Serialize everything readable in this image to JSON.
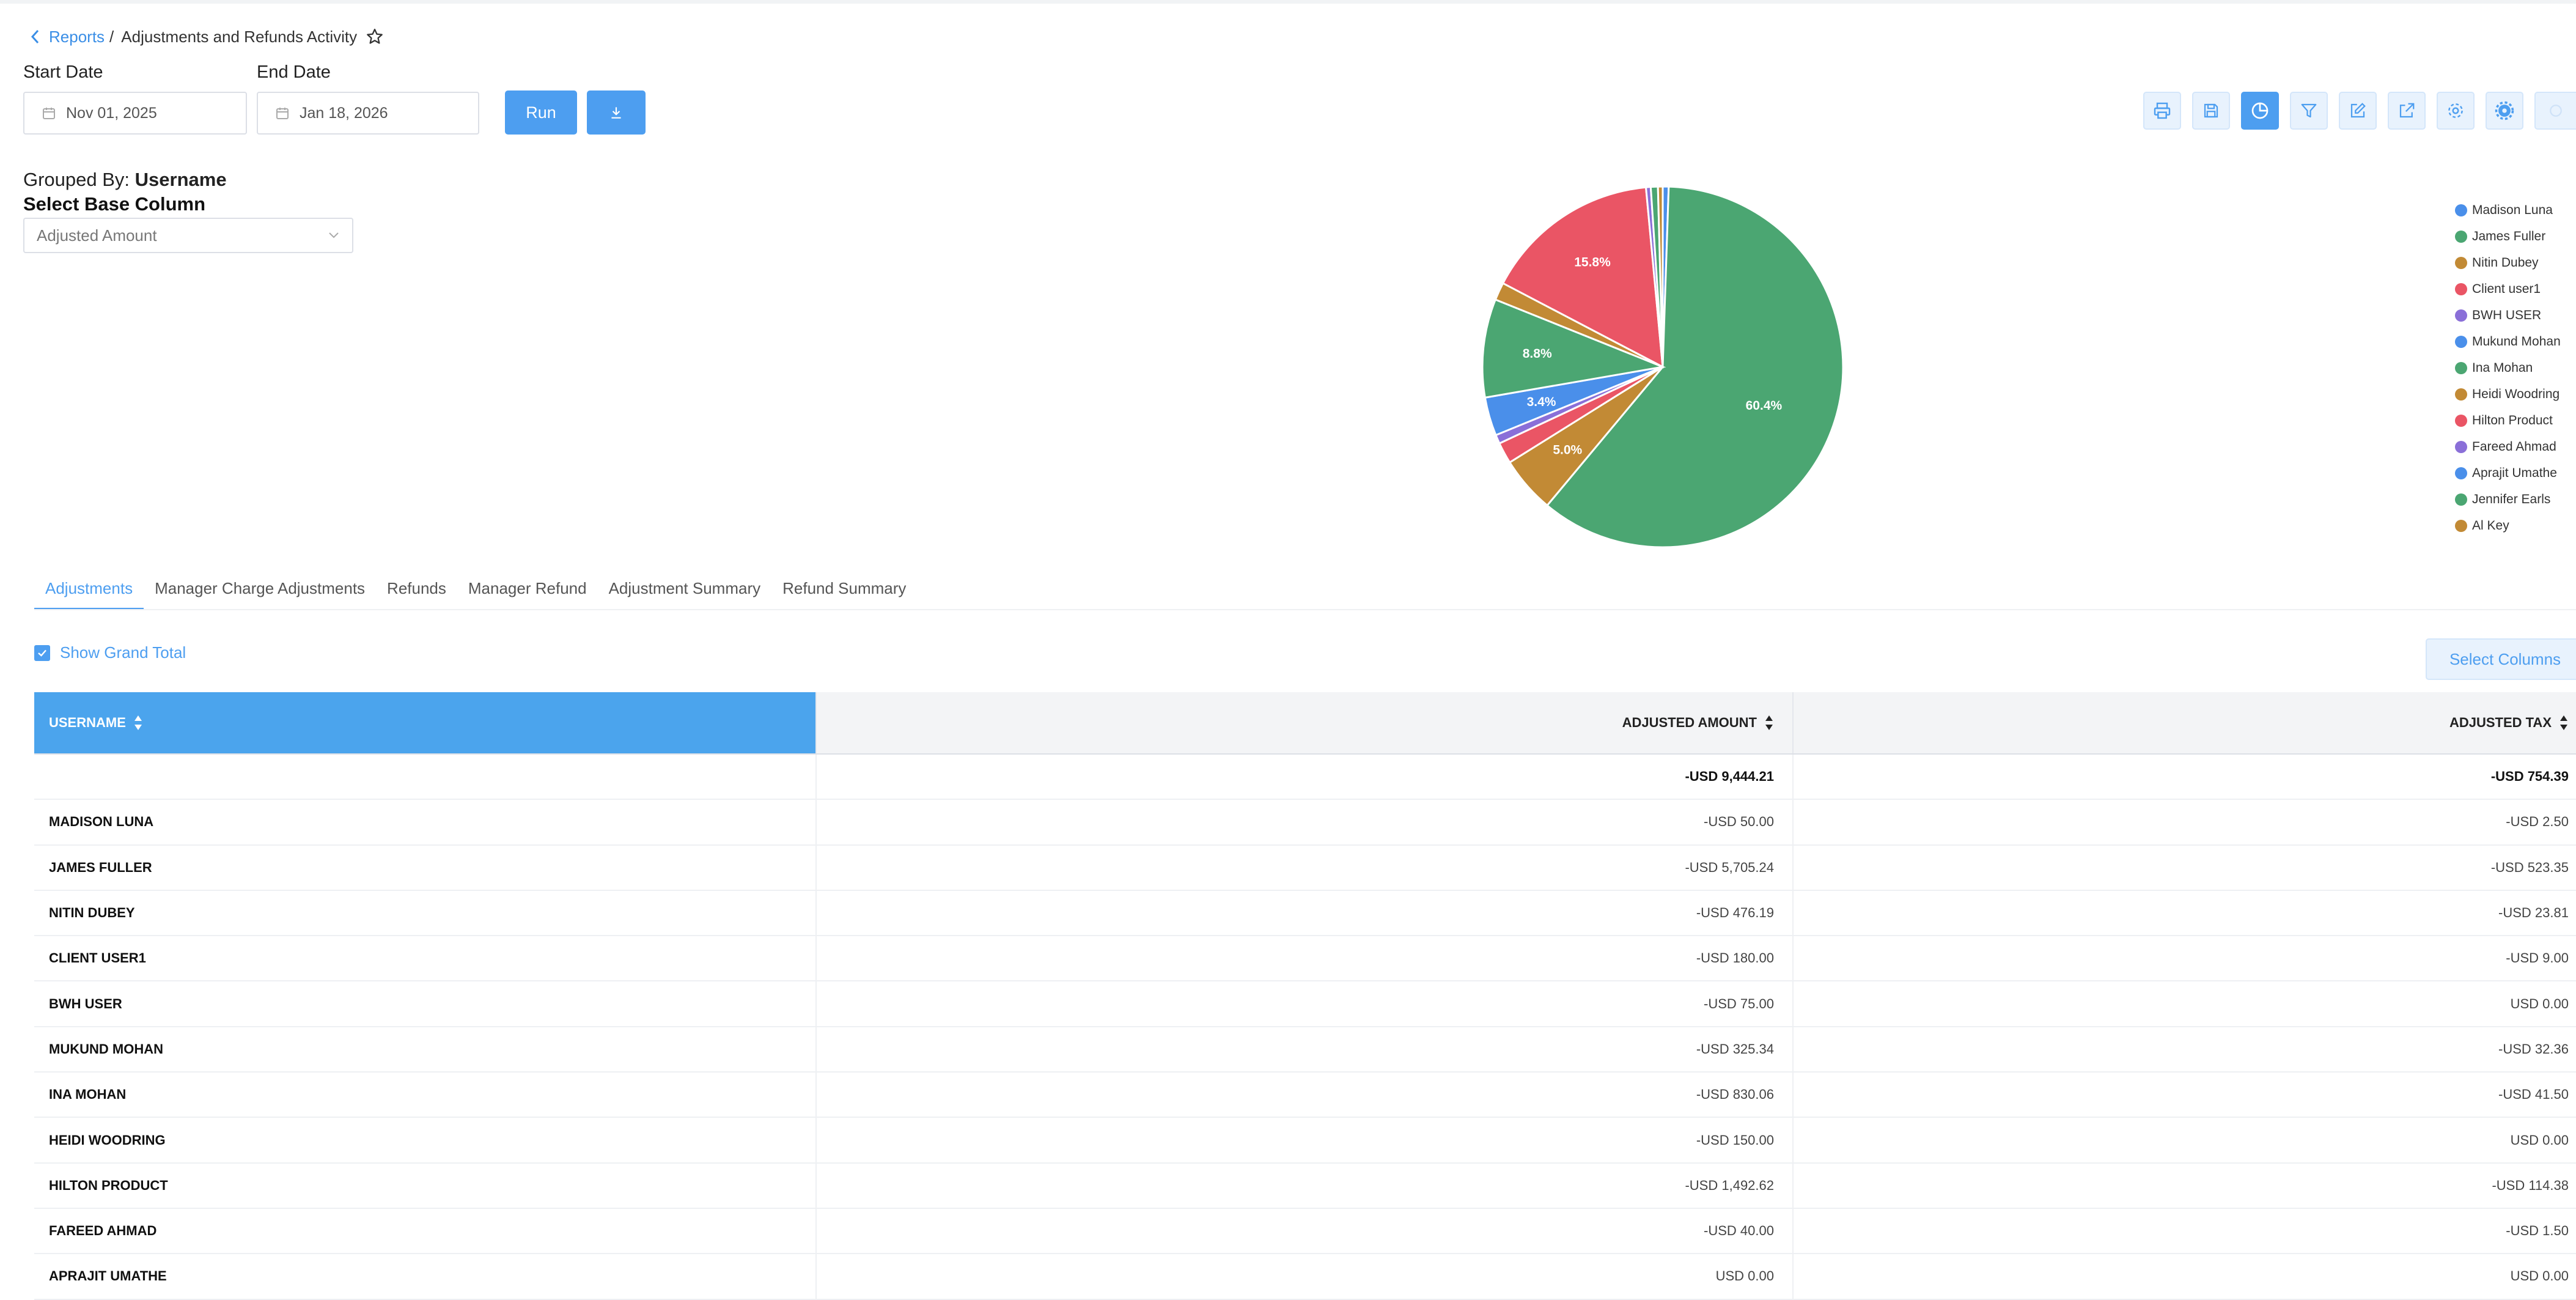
{
  "breadcrumb": {
    "parent": "Reports",
    "separator": "/",
    "title": "Adjustments and Refunds Activity"
  },
  "filters": {
    "start_label": "Start Date",
    "start_value": "Nov 01, 2025",
    "end_label": "End Date",
    "end_value": "Jan 18, 2026",
    "run_label": "Run"
  },
  "toolbar": [
    "print-icon",
    "save-icon",
    "pie-chart-icon",
    "filter-icon",
    "edit-icon",
    "export-icon",
    "settings-icon",
    "advanced-settings-icon",
    "refresh-icon"
  ],
  "grouping": {
    "label": "Grouped By:",
    "value": "Username",
    "base_label": "Select Base Column",
    "base_value": "Adjusted Amount"
  },
  "chart_data": {
    "type": "pie",
    "legend_position": "right",
    "slices": [
      {
        "name": "Madison Luna",
        "value": 50.0,
        "color": "#4a8fea"
      },
      {
        "name": "James Fuller",
        "value": 5705.24,
        "color": "#4ba672",
        "label": "60.4%"
      },
      {
        "name": "Nitin Dubey",
        "value": 476.19,
        "color": "#c28a35",
        "label": "5.0%"
      },
      {
        "name": "Client user1",
        "value": 180.0,
        "color": "#ea5565"
      },
      {
        "name": "BWH USER",
        "value": 75.0,
        "color": "#8a6fd8"
      },
      {
        "name": "Mukund Mohan",
        "value": 325.34,
        "color": "#4a8fea",
        "label": "3.4%"
      },
      {
        "name": "Ina Mohan",
        "value": 830.06,
        "color": "#4ba672",
        "label": "8.8%"
      },
      {
        "name": "Heidi Woodring",
        "value": 150.0,
        "color": "#c28a35"
      },
      {
        "name": "Hilton Product",
        "value": 1492.62,
        "color": "#ea5565",
        "label": "15.8%"
      },
      {
        "name": "Fareed Ahmad",
        "value": 40.0,
        "color": "#8a6fd8"
      },
      {
        "name": "Aprajit Umathe",
        "value": 0.0,
        "color": "#4a8fea"
      },
      {
        "name": "Jennifer Earls",
        "value": 60.0,
        "color": "#4ba672"
      },
      {
        "name": "Al Key",
        "value": 40.0,
        "color": "#c28a35"
      }
    ]
  },
  "legend": [
    {
      "name": "Madison Luna",
      "color": "#4a8fea"
    },
    {
      "name": "James Fuller",
      "color": "#4ba672"
    },
    {
      "name": "Nitin Dubey",
      "color": "#c28a35"
    },
    {
      "name": "Client user1",
      "color": "#ea5565"
    },
    {
      "name": "BWH USER",
      "color": "#8a6fd8"
    },
    {
      "name": "Mukund Mohan",
      "color": "#4a8fea"
    },
    {
      "name": "Ina Mohan",
      "color": "#4ba672"
    },
    {
      "name": "Heidi Woodring",
      "color": "#c28a35"
    },
    {
      "name": "Hilton Product",
      "color": "#ea5565"
    },
    {
      "name": "Fareed Ahmad",
      "color": "#8a6fd8"
    },
    {
      "name": "Aprajit Umathe",
      "color": "#4a8fea"
    },
    {
      "name": "Jennifer Earls",
      "color": "#4ba672"
    },
    {
      "name": "Al Key",
      "color": "#c28a35"
    }
  ],
  "tabs": [
    "Adjustments",
    "Manager Charge Adjustments",
    "Refunds",
    "Manager Refund",
    "Adjustment Summary",
    "Refund Summary"
  ],
  "active_tab": 0,
  "grand_total_label": "Show Grand Total",
  "select_columns_label": "Select Columns",
  "table": {
    "headers": [
      "USERNAME",
      "ADJUSTED AMOUNT",
      "ADJUSTED TAX"
    ],
    "total": [
      "",
      "-USD 9,444.21",
      "-USD 754.39"
    ],
    "rows": [
      [
        "MADISON LUNA",
        "-USD 50.00",
        "-USD 2.50"
      ],
      [
        "JAMES FULLER",
        "-USD 5,705.24",
        "-USD 523.35"
      ],
      [
        "NITIN DUBEY",
        "-USD 476.19",
        "-USD 23.81"
      ],
      [
        "CLIENT USER1",
        "-USD 180.00",
        "-USD 9.00"
      ],
      [
        "BWH USER",
        "-USD 75.00",
        "USD 0.00"
      ],
      [
        "MUKUND MOHAN",
        "-USD 325.34",
        "-USD 32.36"
      ],
      [
        "INA MOHAN",
        "-USD 830.06",
        "-USD 41.50"
      ],
      [
        "HEIDI WOODRING",
        "-USD 150.00",
        "USD 0.00"
      ],
      [
        "HILTON PRODUCT",
        "-USD 1,492.62",
        "-USD 114.38"
      ],
      [
        "FAREED AHMAD",
        "-USD 40.00",
        "-USD 1.50"
      ],
      [
        "APRAJIT UMATHE",
        "USD 0.00",
        "USD 0.00"
      ]
    ]
  }
}
